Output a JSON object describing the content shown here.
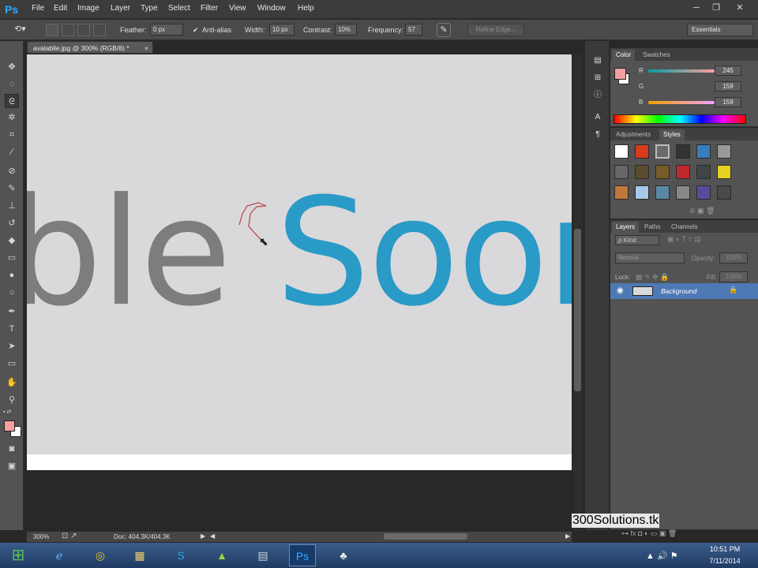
{
  "app": {
    "logo": "Ps"
  },
  "menu": [
    "File",
    "Edit",
    "Image",
    "Layer",
    "Type",
    "Select",
    "Filter",
    "View",
    "Window",
    "Help"
  ],
  "window_controls": {
    "minimize": "─",
    "restore": "❐",
    "close": "✕"
  },
  "options": {
    "feather_label": "Feather:",
    "feather_value": "0 px",
    "antialias_label": "Anti-alias",
    "width_label": "Width:",
    "width_value": "10 px",
    "contrast_label": "Contrast:",
    "contrast_value": "10%",
    "frequency_label": "Frequency:",
    "frequency_value": "57",
    "refine_edge": "Refine Edge...",
    "workspace": "Essentials"
  },
  "document": {
    "tab_title": "avalabile.jpg @ 300% (RGB/8) *",
    "tab_close": "×",
    "canvas_text_gray": "ble ",
    "canvas_text_blue": "Soon",
    "zoom": "300%",
    "doc_size": "Doc: 404,3K/404,3K"
  },
  "color_panel": {
    "tabs": [
      "Color",
      "Swatches"
    ],
    "channels": [
      {
        "label": "R",
        "value": "245"
      },
      {
        "label": "G",
        "value": "159"
      },
      {
        "label": "B",
        "value": "159"
      }
    ],
    "foreground": "#f59f9f"
  },
  "styles_panel": {
    "tabs": [
      "Adjustments",
      "Styles"
    ]
  },
  "layers_panel": {
    "tabs": [
      "Layers",
      "Paths",
      "Channels"
    ],
    "filter_kind": "ρ Kind",
    "blend_mode": "Normal",
    "opacity_label": "Opacity:",
    "opacity_value": "100%",
    "lock_label": "Lock:",
    "fill_label": "Fill:",
    "fill_value": "100%",
    "layer_name": "Background"
  },
  "watermark": "300Solutions.tk",
  "taskbar": {
    "time": "10:51 PM",
    "date": "7/11/2014"
  }
}
